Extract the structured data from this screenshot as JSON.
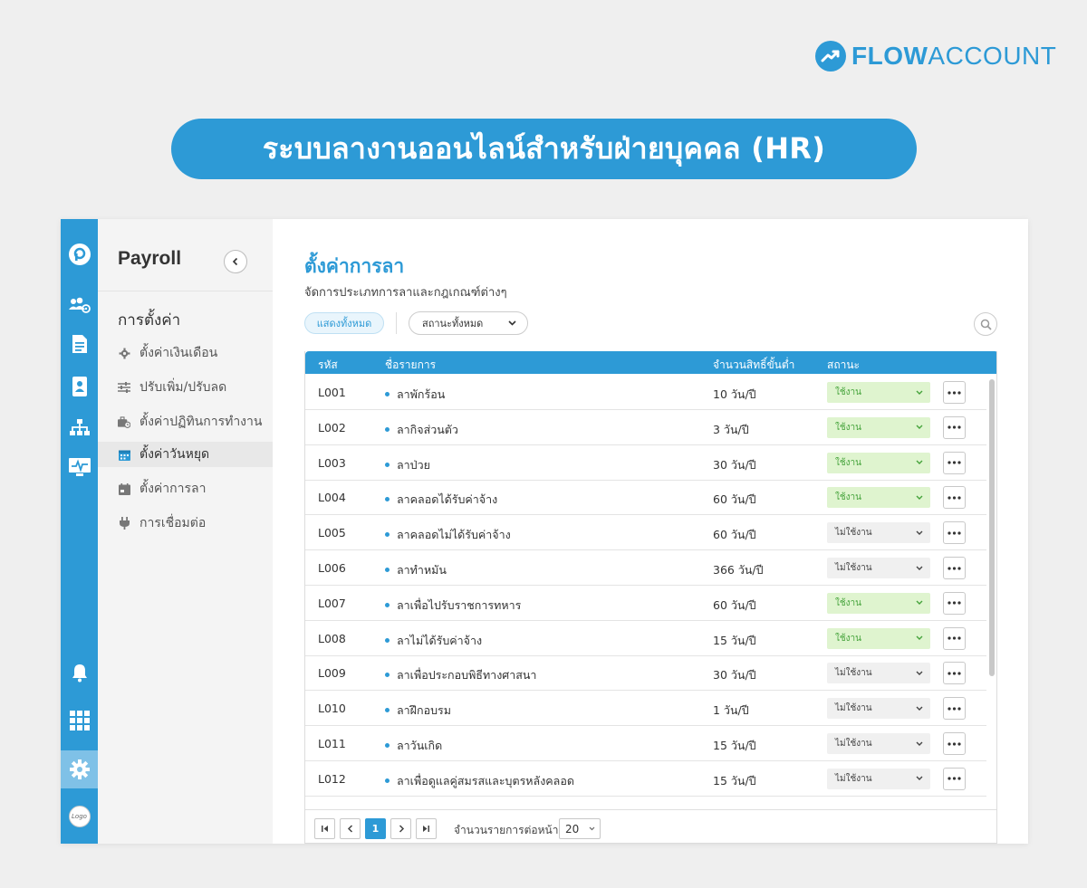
{
  "brand": {
    "name_bold": "FLOW",
    "name_light": "ACCOUNT",
    "accent_color": "#2d9ad6"
  },
  "banner": {
    "title": "ระบบลางานออนไลน์สำหรับฝ่ายบุคคล (HR)"
  },
  "rail": {
    "icons": [
      "app-logo-icon",
      "employees-icon",
      "document-icon",
      "id-card-icon",
      "org-chart-icon",
      "monitor-icon",
      "bell-icon",
      "apps-grid-icon",
      "gear-icon",
      "company-logo-icon"
    ],
    "logo_text": "Logo"
  },
  "sidebar": {
    "title": "Payroll",
    "section": "การตั้งค่า",
    "items": [
      {
        "label": "ตั้งค่าเงินเดือน",
        "icon": "gear-icon"
      },
      {
        "label": "ปรับเพิ่ม/ปรับลด",
        "icon": "sliders-icon"
      },
      {
        "label": "ตั้งค่าปฏิทินการทำงาน",
        "icon": "briefcase-clock-icon"
      },
      {
        "label": "ตั้งค่าวันหยุด",
        "icon": "calendar-icon",
        "active": true
      },
      {
        "label": "ตั้งค่าการลา",
        "icon": "calendar-leave-icon"
      },
      {
        "label": "การเชื่อมต่อ",
        "icon": "plug-icon"
      }
    ]
  },
  "main": {
    "title": "ตั้งค่าการลา",
    "subtitle": "จัดการประเภทการลาและกฎเกณฑ์ต่างๆ",
    "filter_all": "แสดงทั้งหมด",
    "filter_status": "สถานะทั้งหมด"
  },
  "table": {
    "columns": {
      "code": "รหัส",
      "name": "ชื่อรายการ",
      "min_days": "จำนวนสิทธิ์ขั้นต่ำ",
      "status": "สถานะ"
    },
    "status_on_label": "ใช้งาน",
    "status_off_label": "ไม่ใช้งาน",
    "rows": [
      {
        "code": "L001",
        "name": "ลาพักร้อน",
        "days": "10 วัน/ปี",
        "status": "ใช้งาน",
        "active": true
      },
      {
        "code": "L002",
        "name": "ลากิจส่วนตัว",
        "days": "3 วัน/ปี",
        "status": "ใช้งาน",
        "active": true
      },
      {
        "code": "L003",
        "name": "ลาป่วย",
        "days": "30 วัน/ปี",
        "status": "ใช้งาน",
        "active": true
      },
      {
        "code": "L004",
        "name": "ลาคลอดได้รับค่าจ้าง",
        "days": "60 วัน/ปี",
        "status": "ใช้งาน",
        "active": true
      },
      {
        "code": "L005",
        "name": "ลาคลอดไม่ได้รับค่าจ้าง",
        "days": "60 วัน/ปี",
        "status": "ไม่ใช้งาน",
        "active": false
      },
      {
        "code": "L006",
        "name": "ลาทำหมัน",
        "days": "366 วัน/ปี",
        "status": "ไม่ใช้งาน",
        "active": false
      },
      {
        "code": "L007",
        "name": "ลาเพื่อไปรับราชการทหาร",
        "days": "60 วัน/ปี",
        "status": "ใช้งาน",
        "active": true
      },
      {
        "code": "L008",
        "name": "ลาไม่ได้รับค่าจ้าง",
        "days": "15 วัน/ปี",
        "status": "ใช้งาน",
        "active": true
      },
      {
        "code": "L009",
        "name": "ลาเพื่อประกอบพิธีทางศาสนา",
        "days": "30 วัน/ปี",
        "status": "ไม่ใช้งาน",
        "active": false
      },
      {
        "code": "L010",
        "name": "ลาฝึกอบรม",
        "days": "1 วัน/ปี",
        "status": "ไม่ใช้งาน",
        "active": false
      },
      {
        "code": "L011",
        "name": "ลาวันเกิด",
        "days": "15 วัน/ปี",
        "status": "ไม่ใช้งาน",
        "active": false
      },
      {
        "code": "L012",
        "name": "ลาเพื่อดูแลคู่สมรสและบุตรหลังคลอด",
        "days": "15 วัน/ปี",
        "status": "ไม่ใช้งาน",
        "active": false
      }
    ]
  },
  "pagination": {
    "current_page": "1",
    "per_page_label": "จำนวนรายการต่อหน้า",
    "per_page": "20"
  }
}
